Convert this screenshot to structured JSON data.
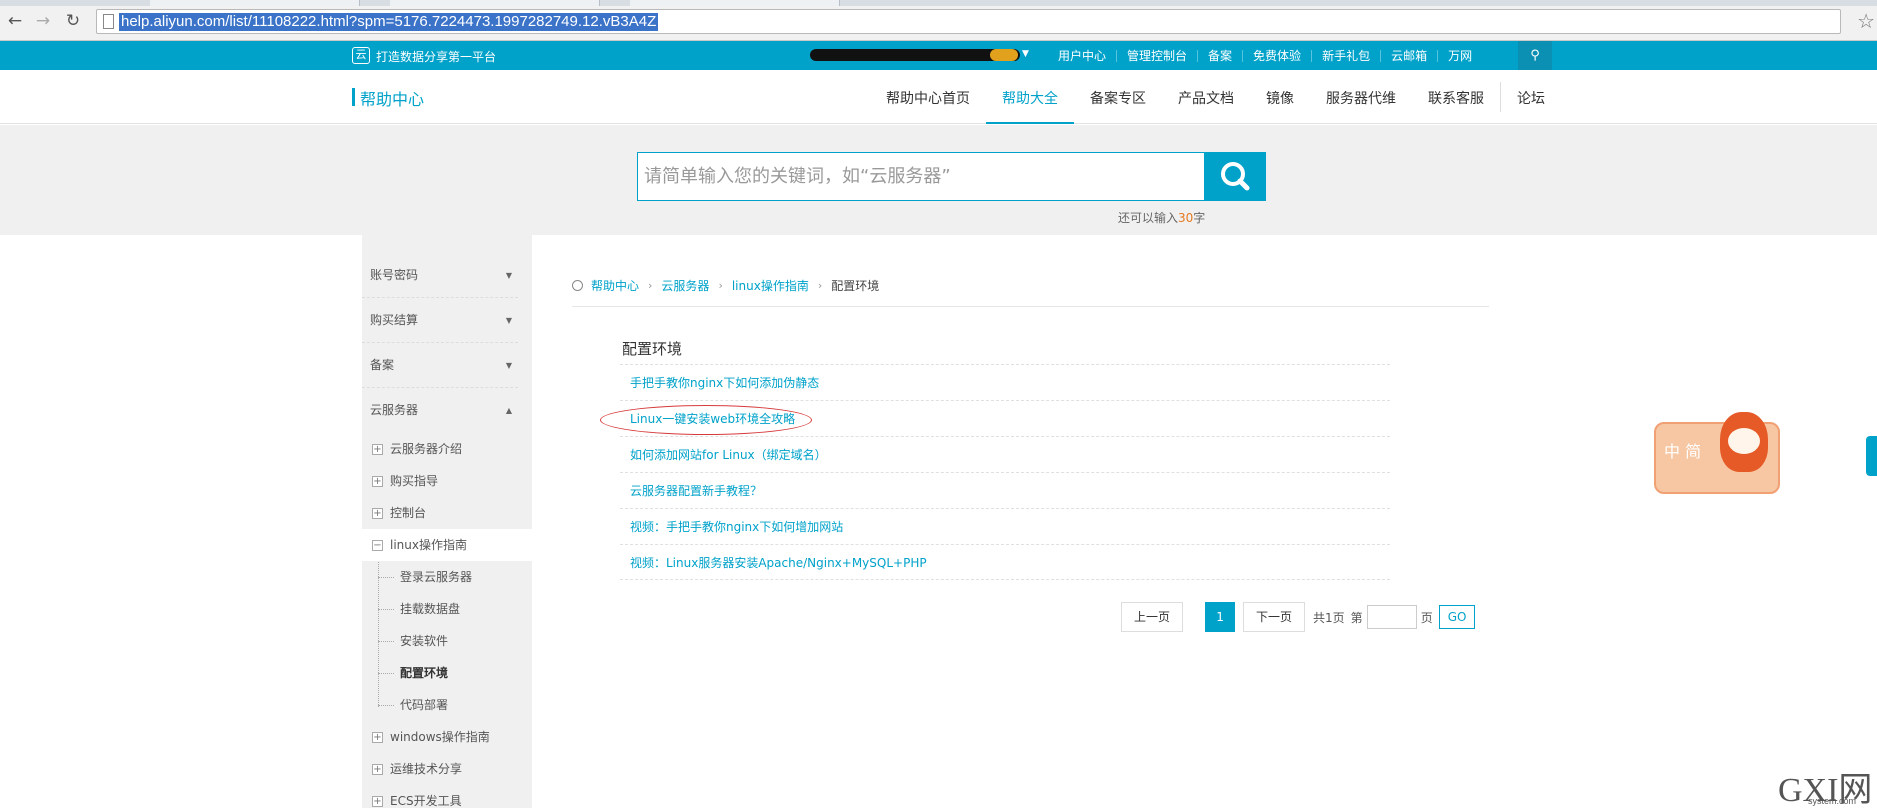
{
  "browser": {
    "url": "help.aliyun.com/list/11108222.html?spm=5176.7224473.1997282749.12.vB3A4Z"
  },
  "topbar": {
    "slogan": "打造数据分享第一平台",
    "links": [
      "用户中心",
      "管理控制台",
      "备案",
      "免费体验",
      "新手礼包",
      "云邮箱",
      "万网"
    ]
  },
  "header": {
    "logo": "帮助中心",
    "nav": [
      "帮助中心首页",
      "帮助大全",
      "备案专区",
      "产品文档",
      "镜像",
      "服务器代维",
      "联系客服",
      "论坛"
    ],
    "active_nav": "帮助大全"
  },
  "search": {
    "placeholder": "请简单输入您的关键词，如“云服务器”",
    "hint_prefix": "还可以输入",
    "hint_count": "30",
    "hint_suffix": "字"
  },
  "sidebar": {
    "categories": [
      "账号密码",
      "购买结算",
      "备案",
      "云服务器"
    ],
    "subs": [
      "云服务器介绍",
      "购买指导",
      "控制台",
      "linux操作指南"
    ],
    "leaves": [
      "登录云服务器",
      "挂载数据盘",
      "安装软件",
      "配置环境",
      "代码部署"
    ],
    "more_subs": [
      "windows操作指南",
      "运维技术分享",
      "ECS开发工具"
    ]
  },
  "breadcrumb": {
    "items": [
      "帮助中心",
      "云服务器",
      "linux操作指南"
    ],
    "current": "配置环境"
  },
  "main": {
    "section_title": "配置环境",
    "articles": [
      "手把手教你nginx下如何添加伪静态",
      "Linux一键安装web环境全攻略",
      "如何添加网站for Linux（绑定域名）",
      "云服务器配置新手教程？",
      "视频：手把手教你nginx下如何增加网站",
      "视频：Linux服务器安装Apache/Nginx+MySQL+PHP"
    ]
  },
  "pager": {
    "prev": "上一页",
    "current_page": "1",
    "next": "下一页",
    "total": "共1页",
    "goto_prefix": "第",
    "goto_suffix": "页",
    "go": "GO"
  },
  "mascot": {
    "label": "中 简"
  },
  "watermark": {
    "main": "GXI网",
    "sub": "system.com"
  },
  "colors": {
    "accent": "#00a2ca",
    "highlight": "#e57a1f",
    "annotation": "#d63b3b"
  }
}
